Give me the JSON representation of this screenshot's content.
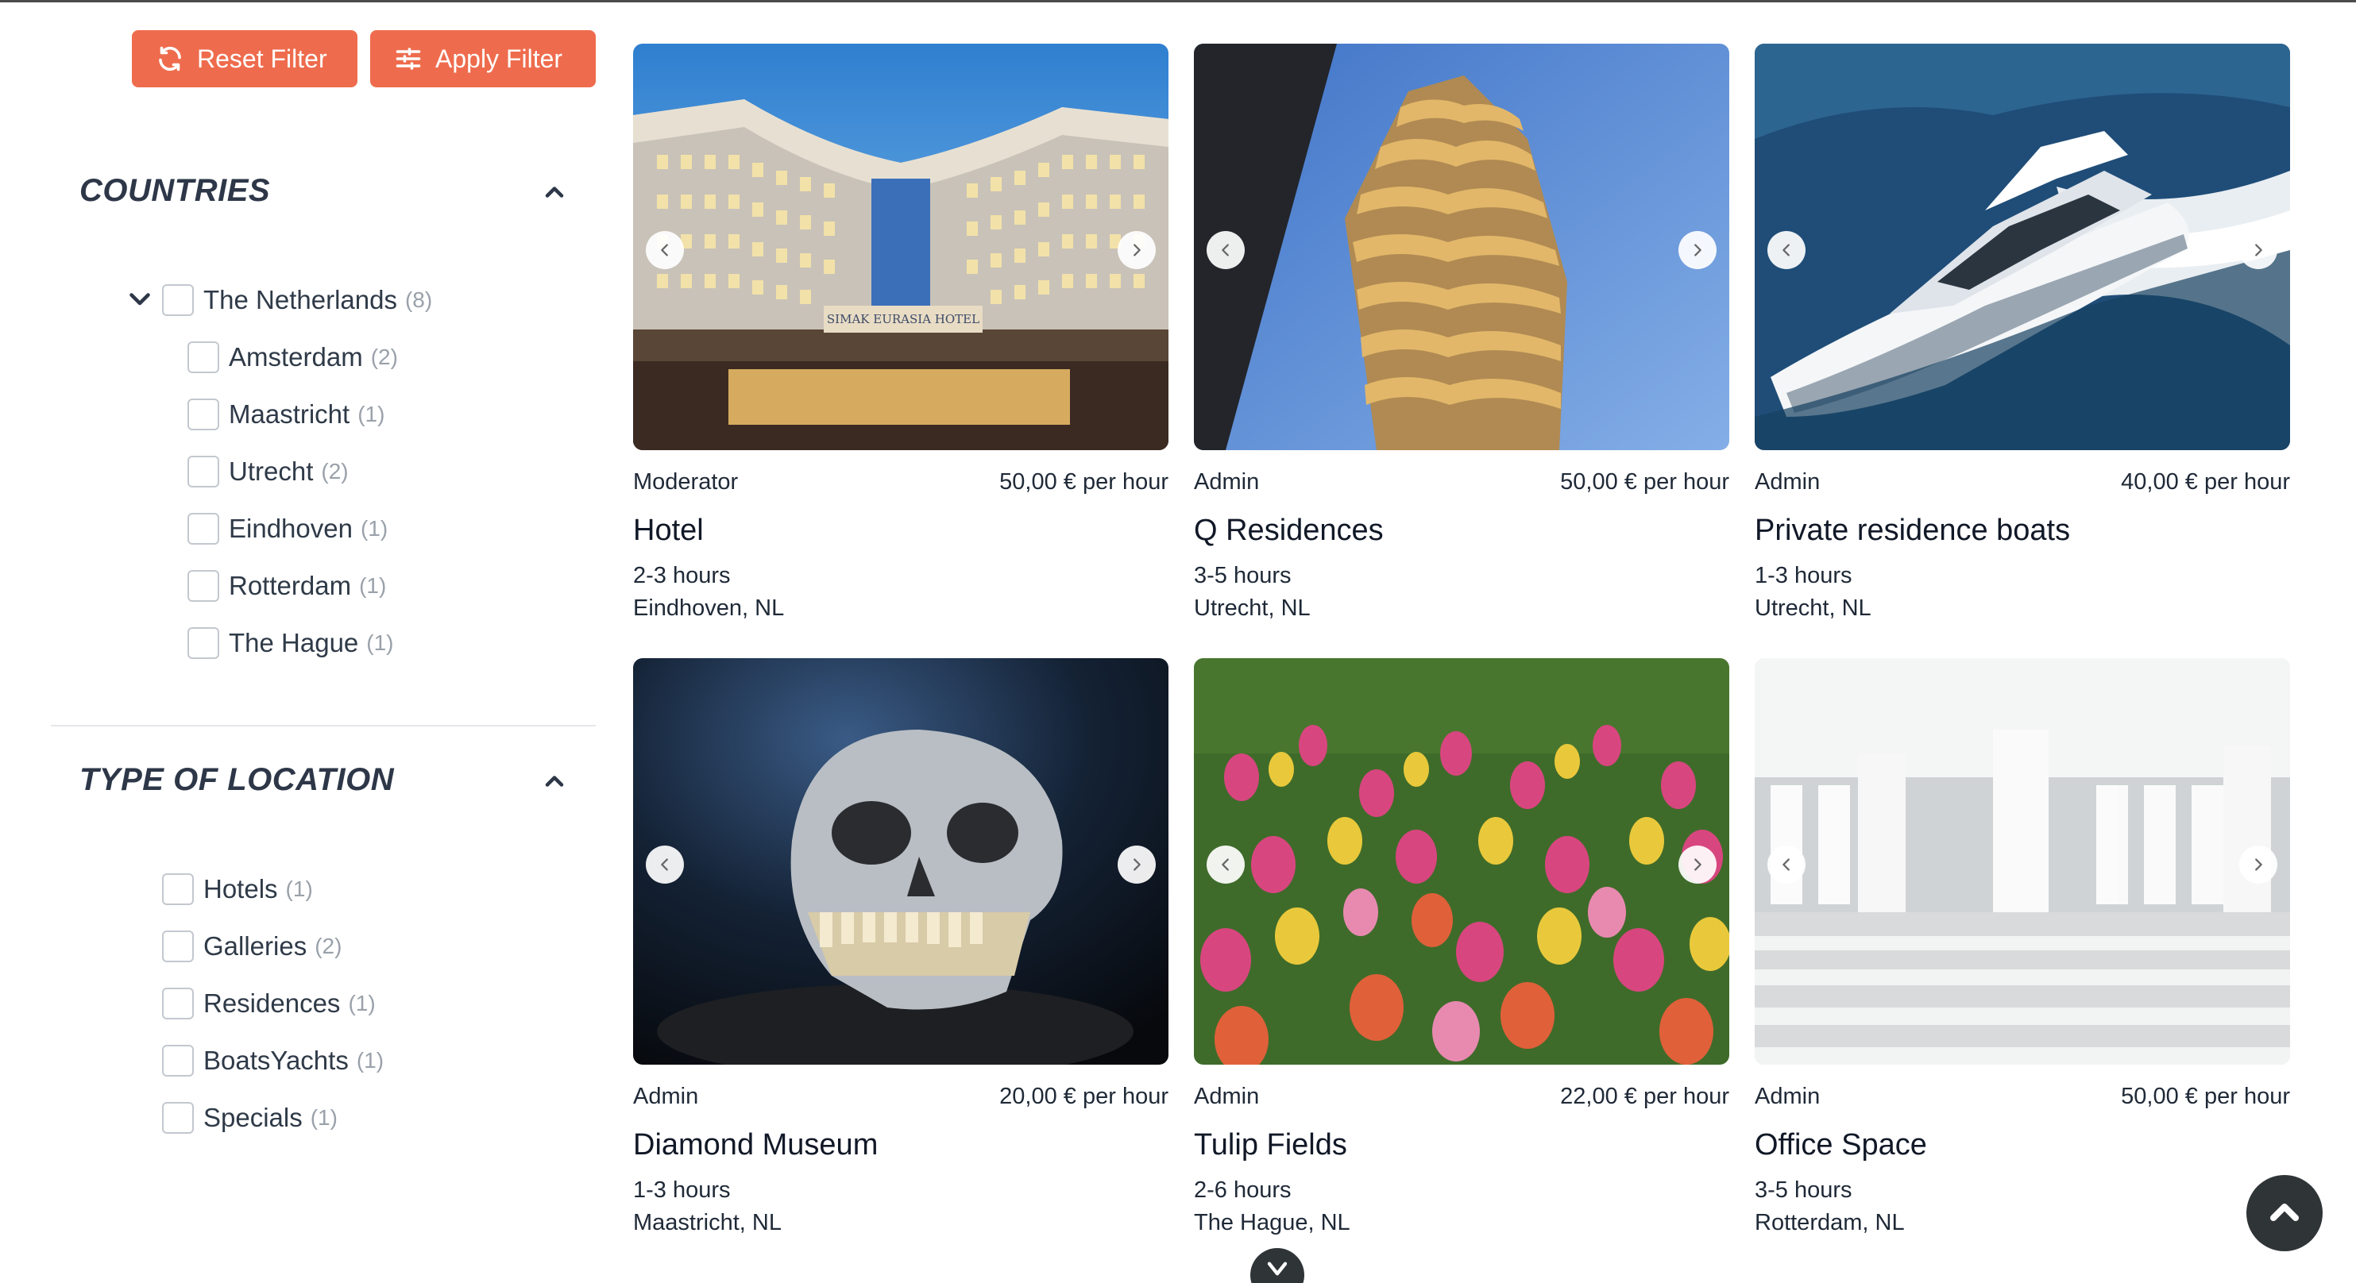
{
  "filters": {
    "reset_label": "Reset Filter",
    "apply_label": "Apply Filter"
  },
  "countries": {
    "title": "COUNTRIES",
    "country": {
      "label": "The Netherlands",
      "count": "(8)"
    },
    "cities": [
      {
        "label": "Amsterdam",
        "count": "(2)"
      },
      {
        "label": "Maastricht",
        "count": "(1)"
      },
      {
        "label": "Utrecht",
        "count": "(2)"
      },
      {
        "label": "Eindhoven",
        "count": "(1)"
      },
      {
        "label": "Rotterdam",
        "count": "(1)"
      },
      {
        "label": "The Hague",
        "count": "(1)"
      }
    ]
  },
  "location_types": {
    "title": "TYPE OF LOCATION",
    "items": [
      {
        "label": "Hotels",
        "count": "(1)"
      },
      {
        "label": "Galleries",
        "count": "(2)"
      },
      {
        "label": "Residences",
        "count": "(1)"
      },
      {
        "label": "BoatsYachts",
        "count": "(1)"
      },
      {
        "label": "Specials",
        "count": "(1)"
      }
    ]
  },
  "listings": [
    {
      "owner": "Moderator",
      "price": "50,00 € per hour",
      "title": "Hotel",
      "duration": "2-3 hours",
      "location": "Eindhoven, NL"
    },
    {
      "owner": "Admin",
      "price": "50,00 € per hour",
      "title": "Q Residences",
      "duration": "3-5 hours",
      "location": "Utrecht, NL"
    },
    {
      "owner": "Admin",
      "price": "40,00 € per hour",
      "title": "Private residence boats",
      "duration": "1-3 hours",
      "location": "Utrecht, NL"
    },
    {
      "owner": "Admin",
      "price": "20,00 € per hour",
      "title": "Diamond Museum",
      "duration": "1-3 hours",
      "location": "Maastricht, NL"
    },
    {
      "owner": "Admin",
      "price": "22,00 € per hour",
      "title": "Tulip Fields",
      "duration": "2-6 hours",
      "location": "The Hague, NL"
    },
    {
      "owner": "Admin",
      "price": "50,00 € per hour",
      "title": "Office Space",
      "duration": "3-5 hours",
      "location": "Rotterdam, NL"
    }
  ],
  "hotel_sign": "SIMAK EURASIA HOTEL",
  "colors": {
    "accent": "#ee6c4d",
    "dark": "#2f3437"
  }
}
